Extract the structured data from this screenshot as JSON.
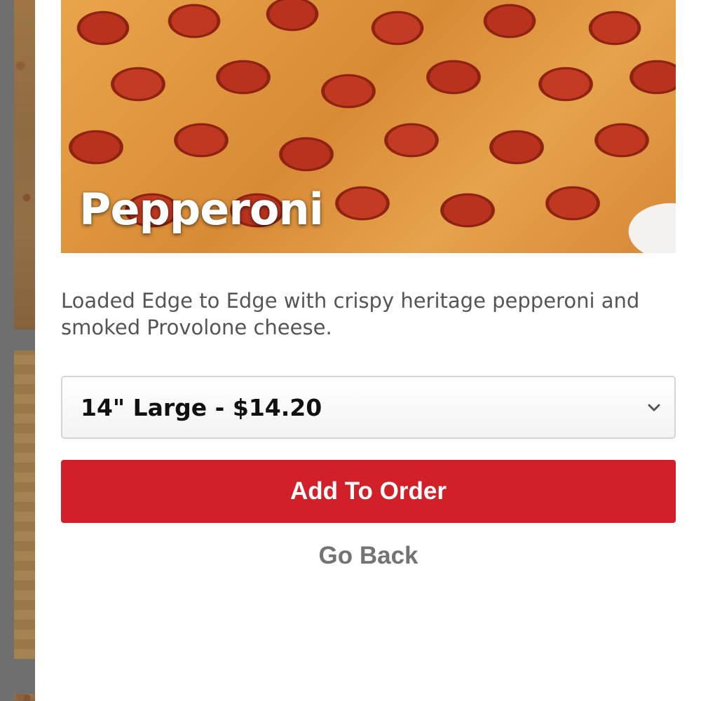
{
  "product": {
    "name": "Pepperoni",
    "description": "Loaded Edge to Edge with crispy heritage pepperoni and smoked Provolone cheese.",
    "image_icon": "pepperoni-pizza-photo"
  },
  "size_select": {
    "selected": "14\" Large - $14.20",
    "icon": "chevron-down-icon"
  },
  "actions": {
    "add_label": "Add To Order",
    "back_label": "Go Back"
  },
  "colors": {
    "accent": "#d2202a",
    "secondary_text": "#737373",
    "overlay": "#7d7d7d"
  }
}
